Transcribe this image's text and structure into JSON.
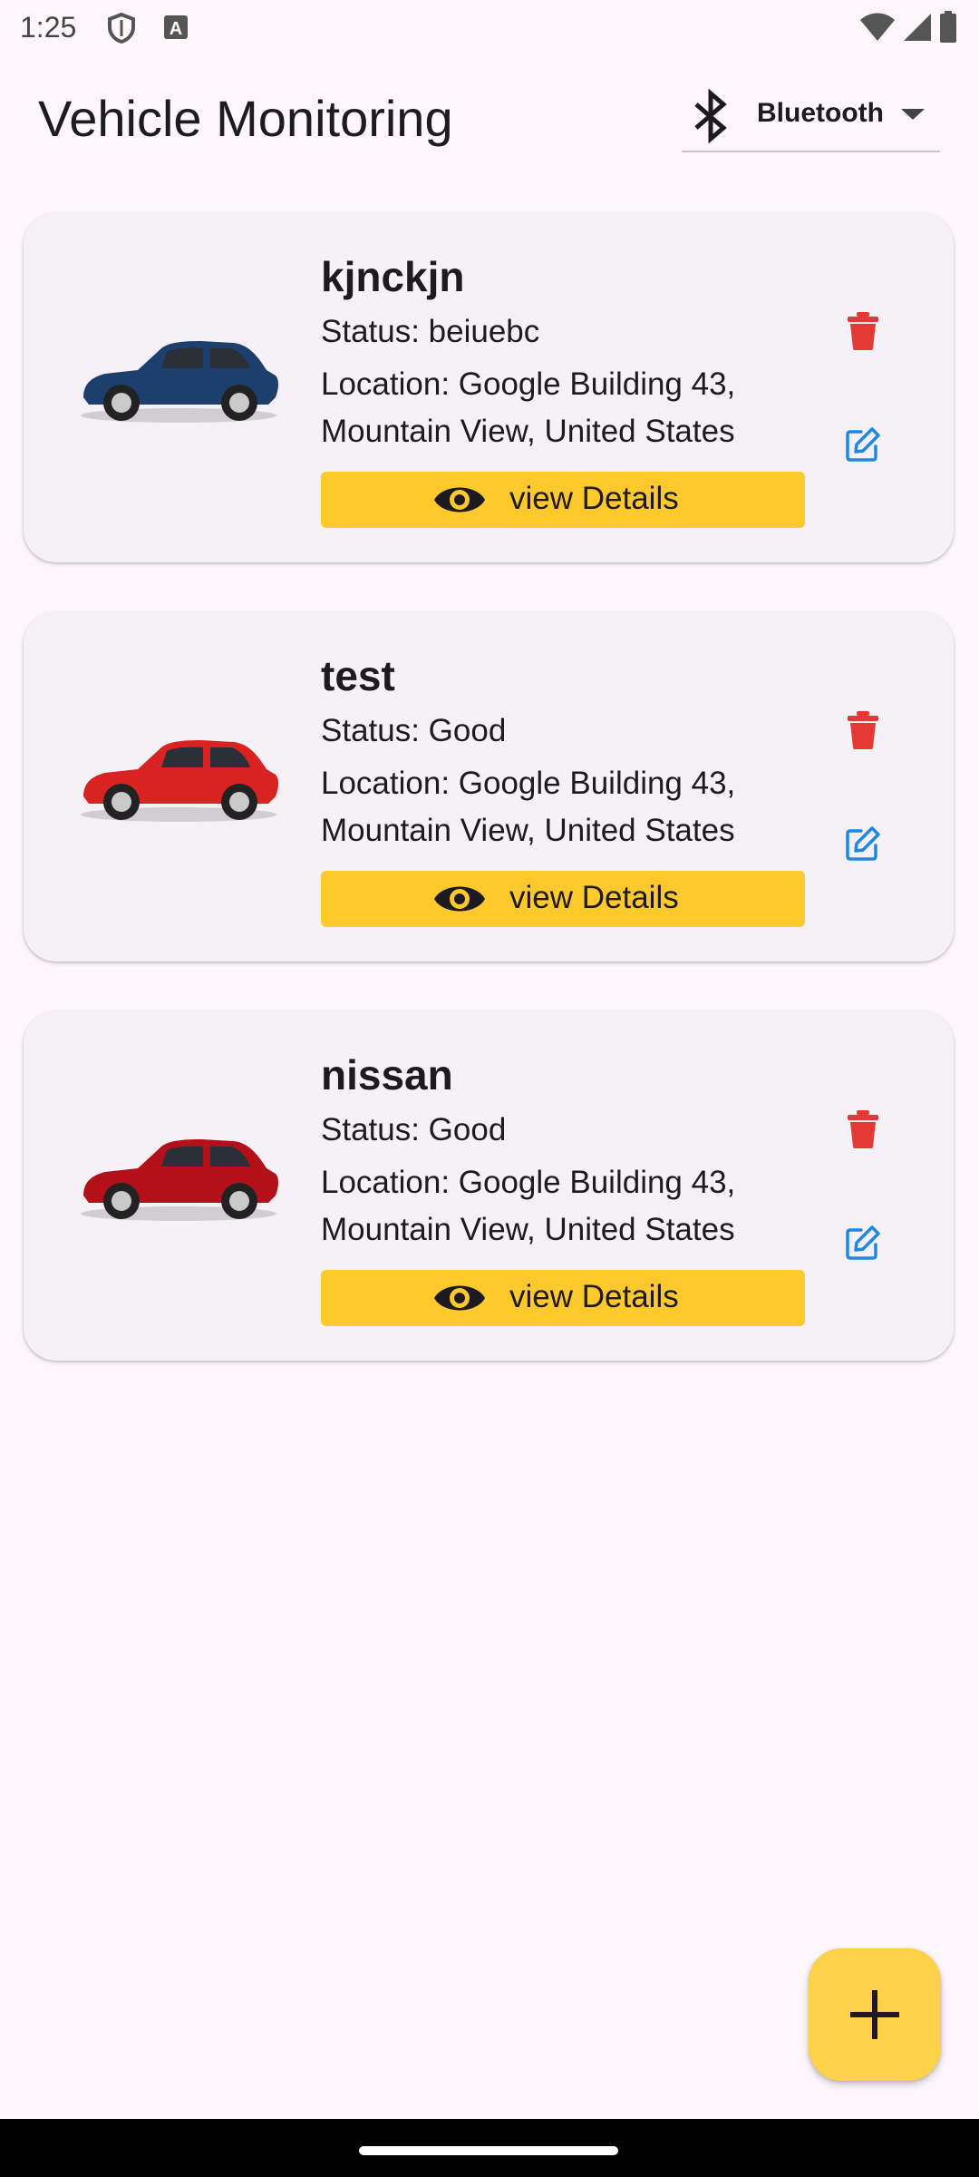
{
  "status_bar": {
    "time": "1:25",
    "icons": [
      "shield-icon",
      "text-a-icon",
      "wifi-icon",
      "signal-icon",
      "battery-icon"
    ]
  },
  "app_bar": {
    "title": "Vehicle Monitoring",
    "connection_select": {
      "icon": "bluetooth-icon",
      "value": "Bluetooth"
    }
  },
  "vehicles": [
    {
      "name": "kjnckjn",
      "status": "Status: beiuebc",
      "location": "Location: Google Building 43, Mountain View, United States",
      "details_label": "view Details",
      "car_color": "#1d3f6e"
    },
    {
      "name": "test",
      "status": "Status: Good",
      "location": "Location: Google Building 43, Mountain View, United States",
      "details_label": "view Details",
      "car_color": "#d92323"
    },
    {
      "name": "nissan",
      "status": "Status: Good",
      "location": "Location: Google Building 43, Mountain View, United States",
      "details_label": "view Details",
      "car_color": "#b3101a"
    }
  ],
  "colors": {
    "background": "#fdf7fc",
    "card": "#f6f1f7",
    "accent_button": "#fdc92c",
    "fab": "#fdd14a",
    "delete": "#e53935",
    "edit": "#1e88e5"
  },
  "fab": {
    "icon": "plus-icon"
  }
}
